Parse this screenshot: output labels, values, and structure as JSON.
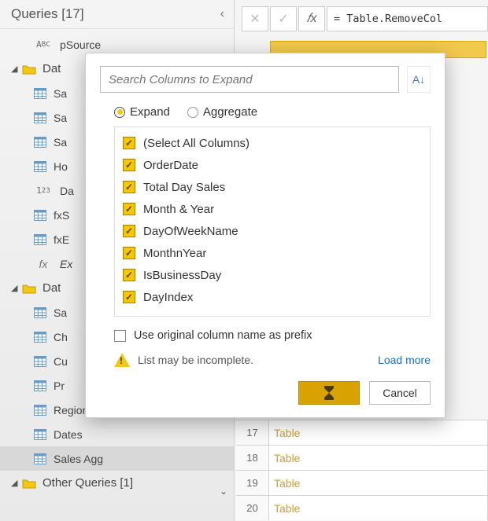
{
  "queriesPanel": {
    "title": "Queries [17]",
    "items": [
      {
        "kind": "leaf",
        "icon": "abc",
        "label": "pSource"
      },
      {
        "kind": "group",
        "icon": "folder",
        "label": "Dat"
      },
      {
        "kind": "leaf",
        "icon": "table",
        "label": "Sa"
      },
      {
        "kind": "leaf",
        "icon": "table",
        "label": "Sa"
      },
      {
        "kind": "leaf",
        "icon": "table",
        "label": "Sa"
      },
      {
        "kind": "leaf",
        "icon": "table",
        "label": "Ho"
      },
      {
        "kind": "leaf",
        "icon": "123",
        "label": "Da"
      },
      {
        "kind": "leaf",
        "icon": "table",
        "label": "fxS"
      },
      {
        "kind": "leaf",
        "icon": "table",
        "label": "fxE"
      },
      {
        "kind": "leaf-fx",
        "icon": "fx",
        "label": "Ex"
      },
      {
        "kind": "group",
        "icon": "folder",
        "label": "Dat"
      },
      {
        "kind": "leaf",
        "icon": "table",
        "label": "Sa"
      },
      {
        "kind": "leaf",
        "icon": "table",
        "label": "Ch"
      },
      {
        "kind": "leaf",
        "icon": "table",
        "label": "Cu"
      },
      {
        "kind": "leaf",
        "icon": "table",
        "label": "Pr"
      },
      {
        "kind": "leaf",
        "icon": "table",
        "label": "Regions"
      },
      {
        "kind": "leaf",
        "icon": "table",
        "label": "Dates"
      },
      {
        "kind": "leaf",
        "icon": "table",
        "label": "Sales Agg",
        "selected": true
      },
      {
        "kind": "group",
        "icon": "folder",
        "label": "Other Queries [1]"
      }
    ]
  },
  "formulaBar": {
    "text": "= Table.RemoveCol"
  },
  "popup": {
    "searchPlaceholder": "Search Columns to Expand",
    "radios": {
      "expand": "Expand",
      "aggregate": "Aggregate",
      "selected": "expand"
    },
    "columns": [
      "(Select All Columns)",
      "OrderDate",
      "Total Day Sales",
      "Month & Year",
      "DayOfWeekName",
      "MonthnYear",
      "IsBusinessDay",
      "DayIndex"
    ],
    "prefixLabel": "Use original column name as prefix",
    "warning": "List may be incomplete.",
    "loadMore": "Load more",
    "cancel": "Cancel"
  },
  "grid": {
    "rows": [
      {
        "n": "17",
        "v": "Table"
      },
      {
        "n": "18",
        "v": "Table"
      },
      {
        "n": "19",
        "v": "Table"
      },
      {
        "n": "20",
        "v": "Table"
      }
    ]
  }
}
